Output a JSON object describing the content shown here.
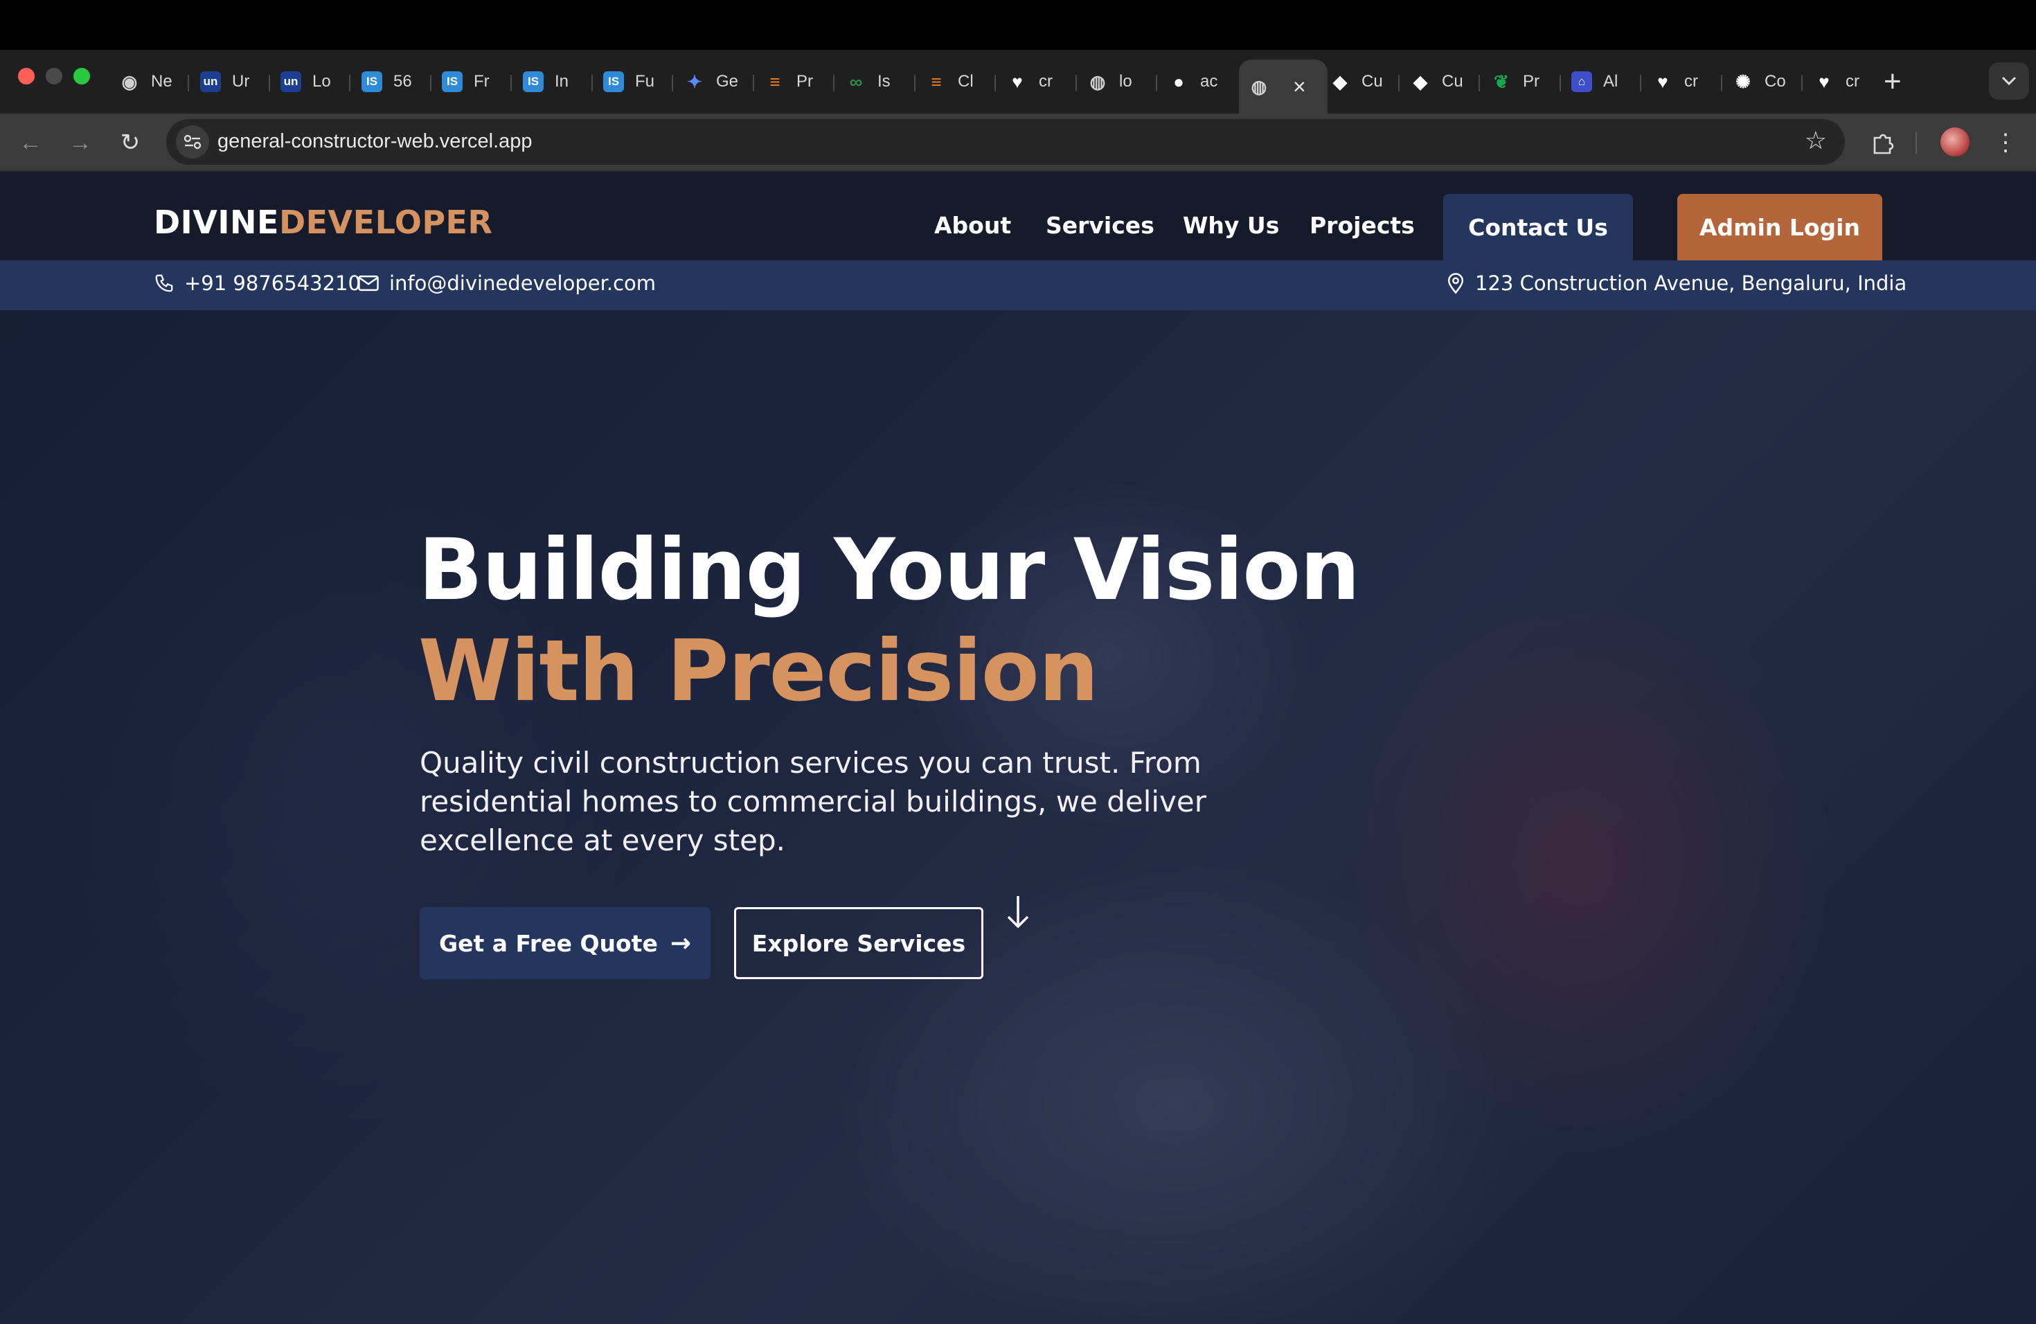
{
  "browser": {
    "tabs": [
      {
        "icon": "chrome-icon",
        "title": "Ne",
        "color": "#cfcfcf"
      },
      {
        "icon": "unstop-icon",
        "title": "Ur",
        "color": "#1c3f94"
      },
      {
        "icon": "unstop-icon",
        "title": "Lo",
        "color": "#1c3f94"
      },
      {
        "icon": "is-icon",
        "title": "56",
        "color": "#2f8ad8"
      },
      {
        "icon": "is-icon",
        "title": "Fr",
        "color": "#2f8ad8"
      },
      {
        "icon": "is-icon",
        "title": "In",
        "color": "#2f8ad8"
      },
      {
        "icon": "is-icon",
        "title": "Fu",
        "color": "#2f8ad8"
      },
      {
        "icon": "gemini-icon",
        "title": "Ge",
        "color": "#5a8cff"
      },
      {
        "icon": "stack-icon",
        "title": "Pr",
        "color": "#f48024"
      },
      {
        "icon": "gfg-icon",
        "title": "Is",
        "color": "#2f8d46"
      },
      {
        "icon": "stack-icon",
        "title": "Cl",
        "color": "#f48024"
      },
      {
        "icon": "heart-icon",
        "title": "cr",
        "color": "#ffffff"
      },
      {
        "icon": "globe-icon",
        "title": "lo",
        "color": "#cfcfcf"
      },
      {
        "icon": "github-icon",
        "title": "ac",
        "color": "#ffffff"
      },
      {
        "icon": "globe-icon",
        "title": "",
        "color": "#cfcfcf",
        "active": true
      },
      {
        "icon": "cube-icon",
        "title": "Cu",
        "color": "#ffffff"
      },
      {
        "icon": "cube-icon",
        "title": "Cu",
        "color": "#ffffff"
      },
      {
        "icon": "mongodb-icon",
        "title": "Pr",
        "color": "#13aa52"
      },
      {
        "icon": "atlas-icon",
        "title": "Al",
        "color": "#3d4ec9"
      },
      {
        "icon": "heart-icon",
        "title": "cr",
        "color": "#ffffff"
      },
      {
        "icon": "openai-icon",
        "title": "Co",
        "color": "#ffffff"
      },
      {
        "icon": "heart-icon",
        "title": "cr",
        "color": "#ffffff"
      }
    ],
    "url": "general-constructor-web.vercel.app"
  },
  "site": {
    "logo_part1": "DIVINE",
    "logo_part2": "DEVELOPER",
    "nav": [
      "About",
      "Services",
      "Why Us",
      "Projects"
    ],
    "contact_button": "Contact Us",
    "admin_button": "Admin Login",
    "phone": "+91 9876543210",
    "email": "info@divinedeveloper.com",
    "address": "123 Construction Avenue, Bengaluru, India",
    "hero_title_line1": "Building Your Vision",
    "hero_title_line2": "With Precision",
    "hero_subtitle": "Quality civil construction services you can trust. From residential homes to commercial buildings, we deliver excellence at every step.",
    "cta_primary": "Get a Free Quote",
    "cta_secondary": "Explore Services"
  },
  "colors": {
    "navy": "#24355e",
    "accent": "#d7935f",
    "admin": "#b5653a",
    "navbar": "#151b2b"
  }
}
